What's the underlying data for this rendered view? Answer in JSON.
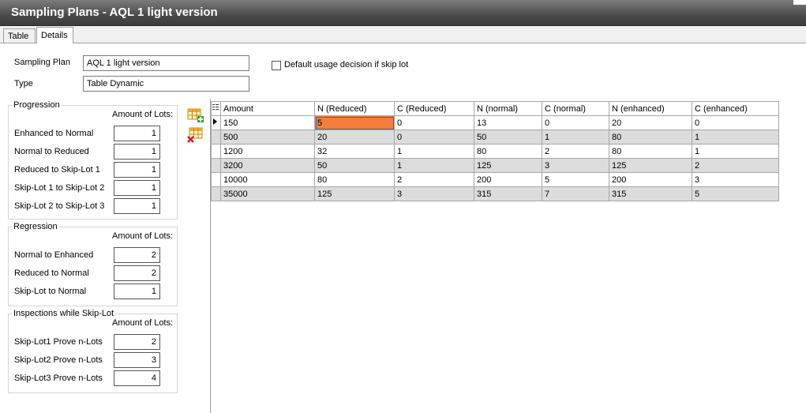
{
  "window": {
    "title": "Sampling Plans - AQL 1 light version"
  },
  "tabs": [
    {
      "label": "Table"
    },
    {
      "label": "Details"
    }
  ],
  "form": {
    "sampling_plan_label": "Sampling Plan",
    "sampling_plan_value": "AQL 1 light version",
    "type_label": "Type",
    "type_value": "Table Dynamic",
    "default_usage_label": "Default usage decision if skip lot",
    "default_usage_checked": false
  },
  "progression": {
    "title": "Progression",
    "amount_header": "Amount of Lots:",
    "rows": [
      {
        "label": "Enhanced to Normal",
        "value": "1"
      },
      {
        "label": "Normal to Reduced",
        "value": "1"
      },
      {
        "label": "Reduced to Skip-Lot 1",
        "value": "1"
      },
      {
        "label": "Skip-Lot 1 to Skip-Lot 2",
        "value": "1"
      },
      {
        "label": "Skip-Lot 2 to Skip-Lot 3",
        "value": "1"
      }
    ]
  },
  "regression": {
    "title": "Regression",
    "amount_header": "Amount of Lots:",
    "rows": [
      {
        "label": "Normal to Enhanced",
        "value": "2"
      },
      {
        "label": "Reduced to Normal",
        "value": "2"
      },
      {
        "label": "Skip-Lot to Normal",
        "value": "1"
      }
    ]
  },
  "inspections": {
    "title": "Inspections while Skip-Lot",
    "amount_header": "Amount of Lots:",
    "rows": [
      {
        "label": "Skip-Lot1 Prove n-Lots",
        "value": "2"
      },
      {
        "label": "Skip-Lot2 Prove n-Lots",
        "value": "3"
      },
      {
        "label": "Skip-Lot3 Prove n-Lots",
        "value": "4"
      }
    ]
  },
  "toolbar": {
    "add_row_icon": "add-row-icon",
    "delete_row_icon": "delete-row-icon"
  },
  "grid": {
    "columns": [
      "Amount",
      "N (Reduced)",
      "C (Reduced)",
      "N (normal)",
      "C (normal)",
      "N (enhanced)",
      "C (enhanced)"
    ],
    "rows": [
      [
        "150",
        "5",
        "0",
        "13",
        "0",
        "20",
        "0"
      ],
      [
        "500",
        "20",
        "0",
        "50",
        "1",
        "80",
        "1"
      ],
      [
        "1200",
        "32",
        "1",
        "80",
        "2",
        "80",
        "1"
      ],
      [
        "3200",
        "50",
        "1",
        "125",
        "3",
        "125",
        "2"
      ],
      [
        "10000",
        "80",
        "2",
        "200",
        "5",
        "200",
        "3"
      ],
      [
        "35000",
        "125",
        "3",
        "315",
        "7",
        "315",
        "5"
      ]
    ],
    "selected_cell": {
      "row": 1,
      "col": 2
    },
    "colors": {
      "selected": "#f47e3c",
      "alt_row": "#dcdcdc"
    }
  }
}
